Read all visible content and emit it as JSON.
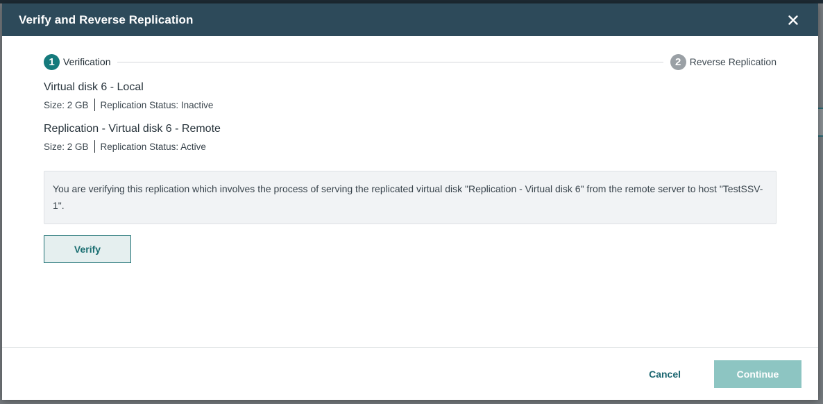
{
  "dialog": {
    "title": "Verify and Reverse Replication",
    "close_icon": "close-icon"
  },
  "stepper": {
    "steps": [
      {
        "number": "1",
        "label": "Verification",
        "state": "active"
      },
      {
        "number": "2",
        "label": "Reverse Replication",
        "state": "inactive"
      }
    ]
  },
  "disks": [
    {
      "name": "Virtual disk 6 - Local",
      "size": "Size: 2 GB",
      "status": "Replication Status: Inactive"
    },
    {
      "name": "Replication - Virtual disk 6 - Remote",
      "size": "Size: 2 GB",
      "status": "Replication Status: Active"
    }
  ],
  "info": {
    "message": "You are verifying this replication which involves the process of serving the replicated virtual disk \"Replication - Virtual disk 6\" from the remote server to host \"TestSSV-1\"."
  },
  "actions": {
    "verify_label": "Verify",
    "cancel_label": "Cancel",
    "continue_label": "Continue"
  },
  "colors": {
    "header_bg": "#2d4a5a",
    "accent": "#157a7c",
    "continue_disabled": "#8dc5c2"
  }
}
